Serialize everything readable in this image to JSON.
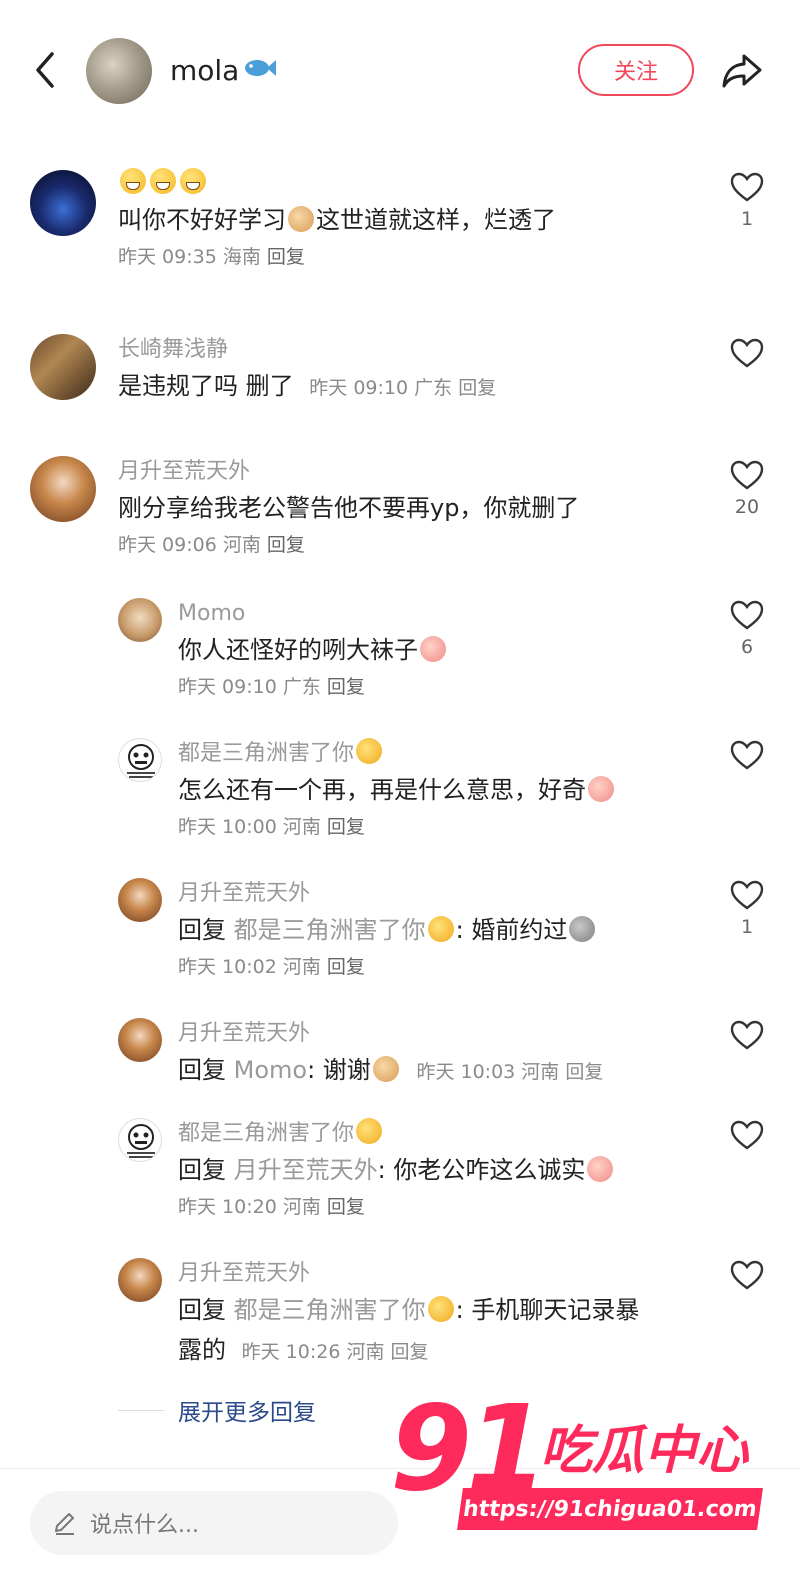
{
  "header": {
    "author_name": "mola",
    "author_emoji": "fish-icon",
    "follow_label": "关注"
  },
  "comments": [
    {
      "nickname": "😄😄😄",
      "text_before": "叫你不好好学习",
      "text_after": "这世道就这样，烂透了",
      "meta_time": "昨天 09:35",
      "meta_region": "海南",
      "reply_label": "回复",
      "likes": "1"
    },
    {
      "nickname": "长崎舞浅静",
      "text": "是违规了吗 删了",
      "meta_time": "昨天 09:10",
      "meta_region": "广东",
      "reply_label": "回复",
      "likes": ""
    },
    {
      "nickname": "月升至荒天外",
      "text": "刚分享给我老公警告他不要再yp，你就删了",
      "meta_time": "昨天 09:06",
      "meta_region": "河南",
      "reply_label": "回复",
      "likes": "20"
    }
  ],
  "replies": [
    {
      "nickname": "Momo",
      "text": "你人还怪好的咧大袜子",
      "meta_time": "昨天 09:10",
      "meta_region": "广东",
      "reply_label": "回复",
      "likes": "6"
    },
    {
      "nickname": "都是三角洲害了你",
      "text": "怎么还有一个再，再是什么意思，好奇",
      "meta_time": "昨天 10:00",
      "meta_region": "河南",
      "reply_label": "回复",
      "likes": ""
    },
    {
      "nickname": "月升至荒天外",
      "reply_prefix": "回复",
      "reply_target": "都是三角洲害了你",
      "text": ": 婚前约过",
      "meta_time": "昨天 10:02",
      "meta_region": "河南",
      "reply_label": "回复",
      "likes": "1"
    },
    {
      "nickname": "月升至荒天外",
      "reply_prefix": "回复",
      "reply_target": "Momo",
      "text": ": 谢谢",
      "meta_time": "昨天 10:03",
      "meta_region": "河南",
      "reply_label": "回复",
      "likes": ""
    },
    {
      "nickname": "都是三角洲害了你",
      "reply_prefix": "回复",
      "reply_target": "月升至荒天外",
      "text": ": 你老公咋这么诚实",
      "meta_time": "昨天 10:20",
      "meta_region": "河南",
      "reply_label": "回复",
      "likes": ""
    },
    {
      "nickname": "月升至荒天外",
      "reply_prefix": "回复",
      "reply_target": "都是三角洲害了你",
      "text": ": 手机聊天记录暴",
      "text_line2": "露的",
      "meta_time": "昨天 10:26",
      "meta_region": "河南",
      "reply_label": "回复",
      "likes": ""
    }
  ],
  "more_replies_label": "展开更多回复",
  "bottom": {
    "input_placeholder": "说点什么..."
  },
  "watermark": {
    "number": "91",
    "name": "吃瓜中心",
    "url": "https://91chigua01.com"
  },
  "colors": {
    "accent": "#f0475a",
    "link": "#2b4a8a",
    "watermark": "#ff2a5c"
  }
}
